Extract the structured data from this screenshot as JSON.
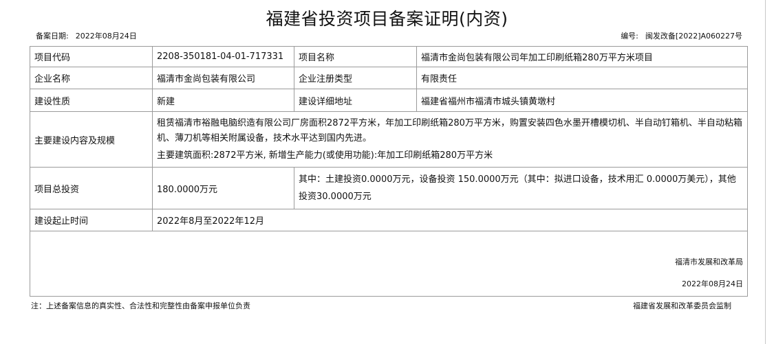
{
  "title": "福建省投资项目备案证明(内资)",
  "record_date": {
    "label": "备案日期:",
    "value": "2022年08月24日"
  },
  "doc_number": {
    "label": "编号:",
    "value": "闽发改备[2022]A060227号"
  },
  "rows": {
    "project_code": {
      "label": "项目代码",
      "value": "2208-350181-04-01-717331"
    },
    "project_name": {
      "label": "项目名称",
      "value": "福清市金尚包装有限公司年加工印刷纸箱280万平方米项目"
    },
    "company_name": {
      "label": "企业名称",
      "value": "福清市金尚包装有限公司"
    },
    "company_type": {
      "label": "企业注册类型",
      "value": "有限责任"
    },
    "construction_nature": {
      "label": "建设性质",
      "value": "新建"
    },
    "address": {
      "label": "建设详细地址",
      "value": "福建省福州市福清市城头镇黄墩村"
    },
    "main_content": {
      "label": "主要建设内容及规模",
      "para1": "租赁福清市裕融电脑织造有限公司厂房面积2872平方米，年加工印刷纸箱280万平方米，购置安装四色水墨开槽模切机、半自动钉箱机、半自动粘箱机、薄刀机等相关附属设备，技术水平达到国内先进。",
      "para2": "主要建筑面积:2872平方米, 新增生产能力(或使用功能):年加工印刷纸箱280万平方米"
    },
    "total_investment": {
      "label": "项目总投资",
      "value": "180.0000万元",
      "detail": "其中：土建投资0.0000万元，设备投资 150.0000万元（其中：拟进口设备，技术用汇 0.0000万美元），其他投资30.0000万元"
    },
    "period": {
      "label": "建设起止时间",
      "value": "2022年8月至2022年12月"
    }
  },
  "signature": {
    "org": "福清市发展和改革局",
    "date": "2022年08月24日"
  },
  "footer": {
    "note": "注：上述备案信息的真实性、合法性和完整性由备案申报单位负责",
    "supervisor": "福建省发展和改革委员会监制"
  }
}
